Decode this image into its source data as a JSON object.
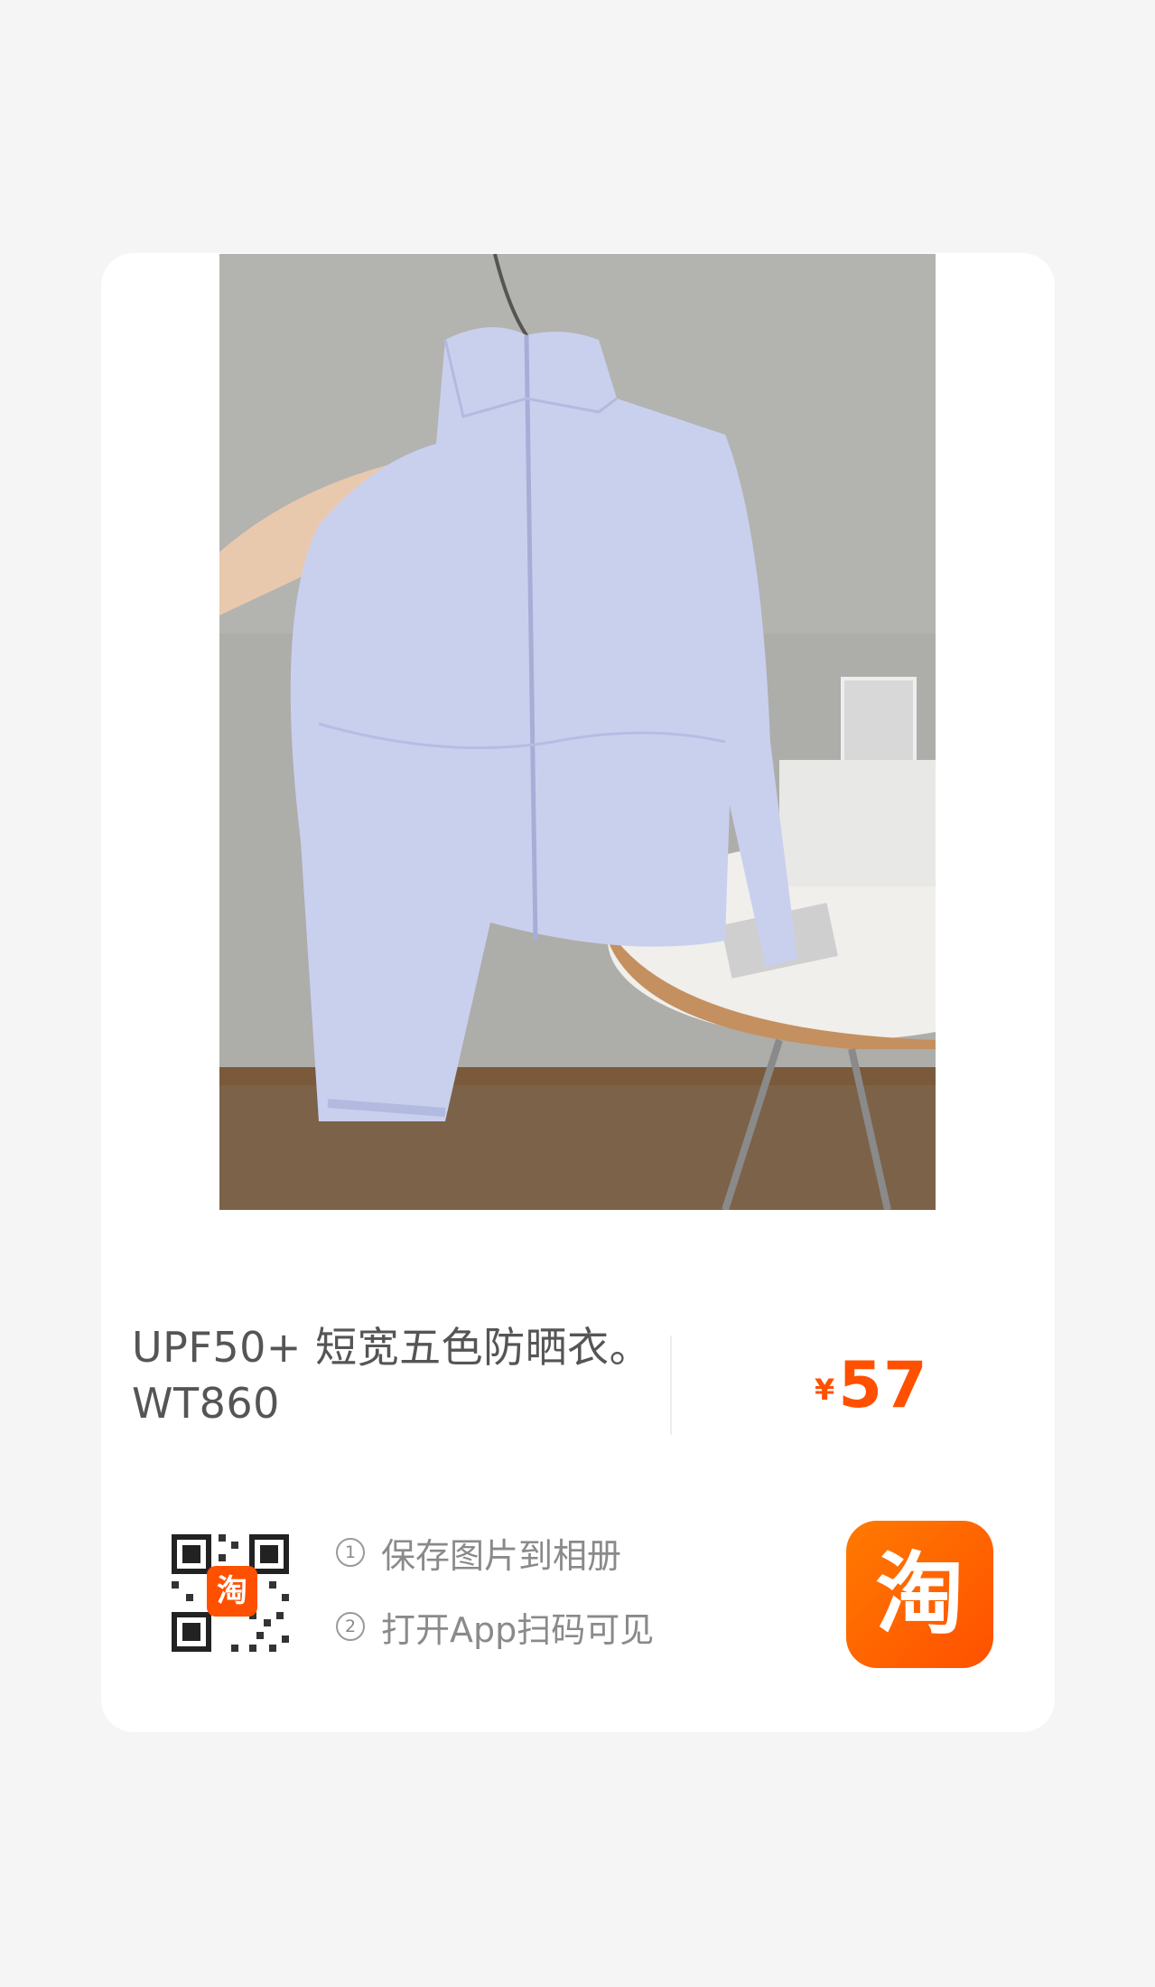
{
  "product": {
    "image_icon": "product-photo-jacket",
    "title_line1": "UPF50+ 短宽五色防晒衣。",
    "title_line2": "WT860",
    "price_currency": "¥",
    "price_amount": "57"
  },
  "share": {
    "qr_icon": "qr-code",
    "qr_badge_text": "淘",
    "steps": [
      {
        "num": "1",
        "text": "保存图片到相册"
      },
      {
        "num": "2",
        "text": "打开App扫码可见"
      }
    ],
    "app_logo_text": "淘"
  },
  "colors": {
    "brand": "#ff5000",
    "background": "#f5f5f5",
    "card": "#ffffff",
    "title_text": "#555555",
    "secondary_text": "#8a8a8a"
  }
}
